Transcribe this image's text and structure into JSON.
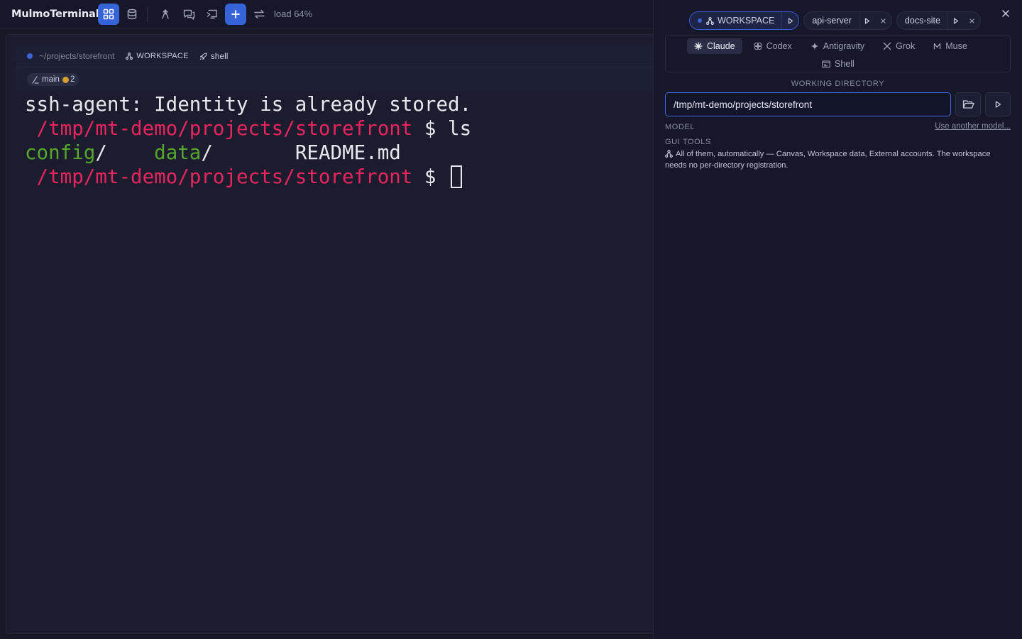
{
  "app": {
    "title": "MulmoTerminal",
    "load": "load 64%"
  },
  "toolbar": {
    "buttons": [
      {
        "icon": "grid-icon",
        "active": true
      },
      {
        "icon": "database-icon",
        "active": false
      },
      {
        "icon": "branch-up-icon",
        "active": false
      },
      {
        "icon": "chat-icon",
        "active": false
      },
      {
        "icon": "terminal-switch-icon",
        "active": false
      },
      {
        "icon": "plus-icon",
        "active": true
      },
      {
        "icon": "swap-icon",
        "active": false
      }
    ]
  },
  "terminal": {
    "path_short": "~/projects/storefront",
    "workspace_label": "WORKSPACE",
    "shell_label": "shell",
    "branch": "main",
    "branch_changes": "2",
    "lines": {
      "l1": "ssh-agent: Identity is already stored.",
      "prompt_path": " /tmp/mt-demo/projects/storefront",
      "prompt_sign": " $ ",
      "cmd": "ls",
      "dir1": "config",
      "dir2": "data",
      "slash": "/",
      "gap1": "    ",
      "gap2": "       ",
      "file1": "README.md"
    }
  },
  "panel": {
    "sessions": [
      {
        "label": "WORKSPACE",
        "active": true
      },
      {
        "label": "api-server",
        "active": false
      },
      {
        "label": "docs-site",
        "active": false
      }
    ],
    "agents": {
      "claude": "Claude",
      "codex": "Codex",
      "antigravity": "Antigravity",
      "grok": "Grok",
      "muse": "Muse",
      "shell": "Shell"
    },
    "working_directory_label": "WORKING DIRECTORY",
    "working_directory_value": "/tmp/mt-demo/projects/storefront",
    "model_label": "MODEL",
    "model_link": "Use another model...",
    "gui_tools_label": "GUI TOOLS",
    "gui_tools_desc": "All of them, automatically — Canvas, Workspace data, External accounts. The workspace needs no per-directory registration."
  },
  "colors": {
    "accent": "#3563d8",
    "prompt_red": "#e8255e",
    "dir_green": "#56a62c",
    "branch_dot": "#d7a02c"
  }
}
